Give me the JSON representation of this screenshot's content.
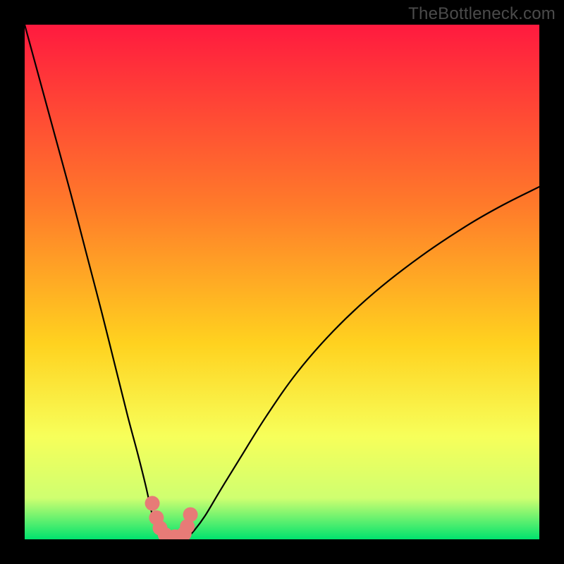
{
  "attribution": "TheBottleneck.com",
  "colors": {
    "frame": "#000000",
    "gradient_top": "#ff1a3f",
    "gradient_mid1": "#ff7a2a",
    "gradient_mid2": "#ffd21f",
    "gradient_mid3": "#f7ff5a",
    "gradient_mid4": "#cfff70",
    "gradient_bottom": "#00e36e",
    "curve": "#000000",
    "markers": "#e77b77"
  },
  "chart_data": {
    "type": "line",
    "title": "",
    "xlabel": "",
    "ylabel": "",
    "xlim": [
      0,
      100
    ],
    "ylim": [
      0,
      100
    ],
    "series": [
      {
        "name": "left-branch",
        "x": [
          0,
          3,
          6,
          9,
          12,
          15,
          17.5,
          20,
          22,
          23.5,
          24.5,
          25.2,
          25.8,
          26.2,
          26.5
        ],
        "values": [
          100,
          89,
          78,
          67,
          55.5,
          44,
          34,
          24,
          16.5,
          10.5,
          6,
          3.2,
          1.6,
          0.7,
          0.3
        ]
      },
      {
        "name": "valley-floor",
        "x": [
          26.5,
          27.5,
          29.0,
          30.5,
          31.5
        ],
        "values": [
          0.3,
          0.05,
          0.0,
          0.05,
          0.3
        ]
      },
      {
        "name": "right-branch",
        "x": [
          31.5,
          33,
          35,
          38,
          42,
          47,
          53,
          60,
          68,
          77,
          86,
          93,
          100
        ],
        "values": [
          0.3,
          1.8,
          4.5,
          9.5,
          16,
          24,
          32.5,
          40.5,
          48,
          55,
          61,
          65,
          68.5
        ]
      }
    ],
    "markers": {
      "name": "valley-markers",
      "x": [
        24.8,
        25.6,
        26.3,
        27.3,
        29.2,
        31.0,
        31.6,
        32.2
      ],
      "values": [
        7.0,
        4.2,
        2.2,
        0.9,
        0.5,
        1.1,
        2.5,
        4.8
      ]
    },
    "annotations": []
  }
}
